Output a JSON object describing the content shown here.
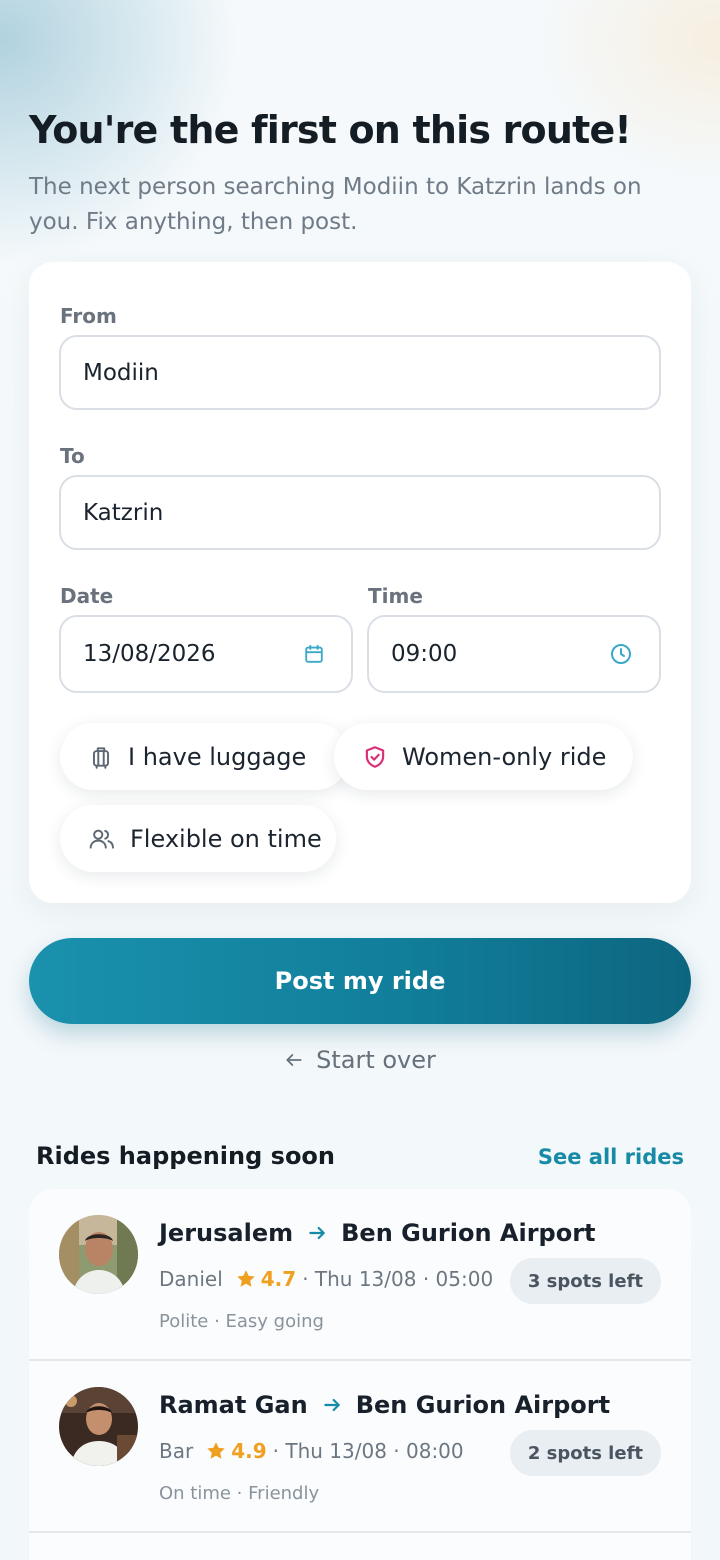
{
  "header": {
    "title": "You're the first on this route!",
    "subtitle": "The next person searching Modiin to Katzrin lands on you. Fix anything, then post."
  },
  "form": {
    "from_label": "From",
    "from_value": "Modiin",
    "to_label": "To",
    "to_value": "Katzrin",
    "date_label": "Date",
    "date_value": "13/08/2026",
    "time_label": "Time",
    "time_value": "09:00",
    "chips": {
      "luggage": "I have luggage",
      "women_only": "Women-only ride",
      "flexible": "Flexible on time"
    }
  },
  "actions": {
    "post_label": "Post my ride",
    "start_over_label": "Start over"
  },
  "upcoming": {
    "title": "Rides happening soon",
    "see_all": "See all rides",
    "rides": [
      {
        "from": "Jerusalem",
        "to": "Ben Gurion Airport",
        "driver": "Daniel",
        "rating": "4.7",
        "when": "· Thu 13/08 · 05:00",
        "spots": "3 spots left",
        "tags": "Polite · Easy going"
      },
      {
        "from": "Ramat Gan",
        "to": "Ben Gurion Airport",
        "driver": "Bar",
        "rating": "4.9",
        "when": "· Thu 13/08 · 08:00",
        "spots": "2 spots left",
        "tags": "On time · Friendly"
      }
    ]
  },
  "colors": {
    "accent": "#178aa6",
    "button_start": "#1a91ad",
    "button_end": "#0d6680",
    "rating": "#f0a020",
    "women_only_icon": "#d9307a"
  },
  "icons": {
    "date": "calendar-icon",
    "time": "clock-icon",
    "luggage": "luggage-icon",
    "women_only": "shield-icon",
    "flexible": "people-icon",
    "start_over": "arrow-left-icon",
    "route": "arrow-right-icon",
    "rating": "star-icon"
  }
}
